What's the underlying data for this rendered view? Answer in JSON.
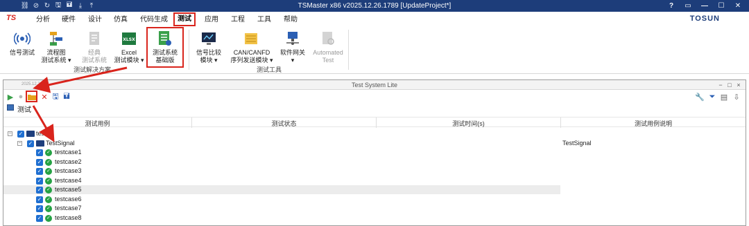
{
  "window": {
    "title": "TSMaster x86 v2025.12.26.1789 [UpdateProject*]",
    "controls": [
      "?",
      "▭",
      "—",
      "☐",
      "✕"
    ]
  },
  "menu": {
    "items": [
      "分析",
      "硬件",
      "设计",
      "仿真",
      "代码生成",
      "测试",
      "应用",
      "工程",
      "工具",
      "帮助"
    ],
    "active": "测试",
    "brand": "TOSUN"
  },
  "ribbon": {
    "buttons": [
      {
        "label1": "信号测试",
        "label2": "",
        "enabled": true
      },
      {
        "label1": "流程图",
        "label2": "测试系统 ▾",
        "enabled": true
      },
      {
        "label1": "经典",
        "label2": "测试系统",
        "enabled": false
      },
      {
        "label1": "Excel",
        "label2": "测试模块 ▾",
        "enabled": true
      },
      {
        "label1": "测试系统",
        "label2": "基础版",
        "enabled": true
      },
      {
        "label1": "信号比较",
        "label2": "模块 ▾",
        "enabled": true
      },
      {
        "label1": "CAN/CANFD",
        "label2": "序列发送模块 ▾",
        "enabled": true
      },
      {
        "label1": "软件网关",
        "label2": "▾",
        "enabled": true
      },
      {
        "label1": "Automated",
        "label2": "Test",
        "enabled": false
      }
    ],
    "groups": [
      "测试解决方案",
      "测试工具"
    ]
  },
  "panel": {
    "title": "Test System Lite",
    "timestamp": "2025.12.24.15",
    "tab_label": "测试"
  },
  "grid": {
    "columns": [
      "测试用例",
      "测试状态",
      "测试时间(s)",
      "测试用例说明"
    ],
    "rows": [
      {
        "name": "test",
        "level": 0,
        "type": "folder",
        "desc": ""
      },
      {
        "name": "TestSignal",
        "level": 1,
        "type": "folder",
        "desc": "TestSignal"
      },
      {
        "name": "testcase1",
        "level": 2,
        "type": "case",
        "desc": ""
      },
      {
        "name": "testcase2",
        "level": 2,
        "type": "case",
        "desc": ""
      },
      {
        "name": "testcase3",
        "level": 2,
        "type": "case",
        "desc": ""
      },
      {
        "name": "testcase4",
        "level": 2,
        "type": "case",
        "desc": ""
      },
      {
        "name": "testcase5",
        "level": 2,
        "type": "case",
        "desc": ""
      },
      {
        "name": "testcase6",
        "level": 2,
        "type": "case",
        "desc": ""
      },
      {
        "name": "testcase7",
        "level": 2,
        "type": "case",
        "desc": ""
      },
      {
        "name": "testcase8",
        "level": 2,
        "type": "case",
        "desc": ""
      }
    ],
    "selected_row": "testcase5"
  },
  "colors": {
    "titlebar": "#1d3d7a",
    "highlight": "#d9241c",
    "checkbox": "#1f6fd1",
    "pass": "#25a244"
  }
}
